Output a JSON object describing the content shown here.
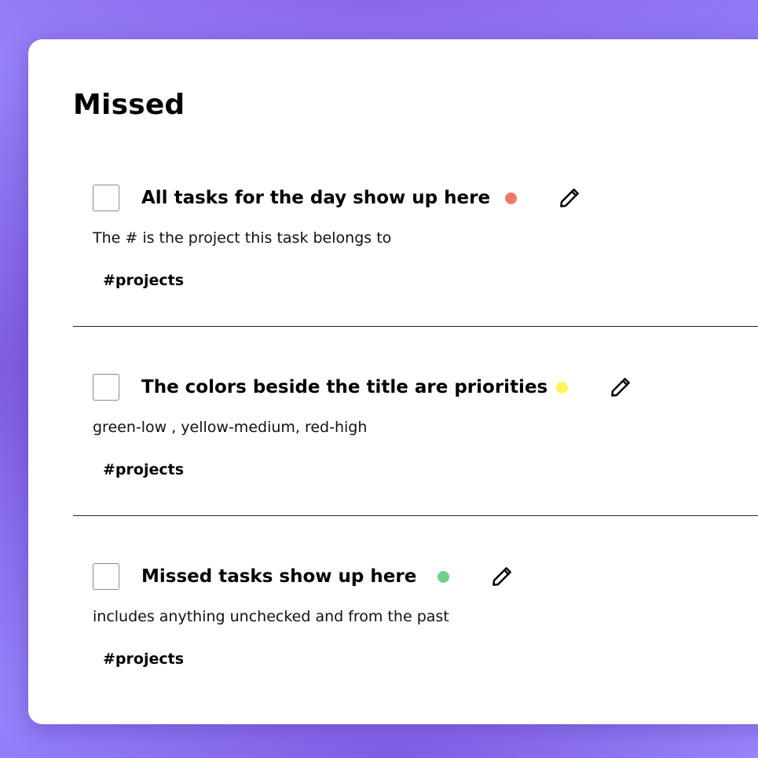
{
  "section": {
    "title": "Missed"
  },
  "tasks": [
    {
      "title": "All tasks for the day show up here",
      "description": "The # is the project this task belongs to",
      "tag": "#projects",
      "priority": "high",
      "priority_color": "#f07a6a"
    },
    {
      "title": "The colors beside the title are priorities",
      "description": "green-low , yellow-medium, red-high",
      "tag": "#projects",
      "priority": "medium",
      "priority_color": "#fbf55c"
    },
    {
      "title": "Missed tasks show up here",
      "description": "includes anything unchecked and from the past",
      "tag": "#projects",
      "priority": "low",
      "priority_color": "#6fd08c"
    }
  ],
  "icons": {
    "checkbox": "checkbox-icon",
    "edit": "pencil-icon"
  }
}
